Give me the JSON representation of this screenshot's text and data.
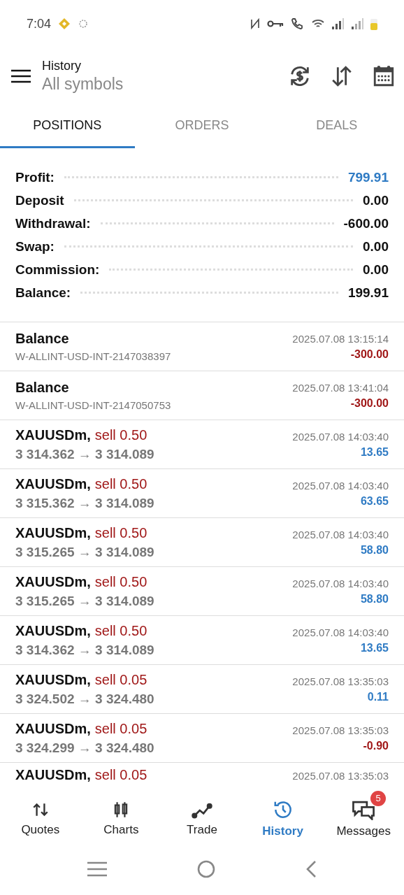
{
  "status_bar": {
    "time": "7:04"
  },
  "header": {
    "title": "History",
    "subtitle": "All symbols"
  },
  "tabs": [
    {
      "label": "POSITIONS",
      "selected": true
    },
    {
      "label": "ORDERS",
      "selected": false
    },
    {
      "label": "DEALS",
      "selected": false
    }
  ],
  "summary": [
    {
      "label": "Profit:",
      "value": "799.91",
      "highlight": true
    },
    {
      "label": "Deposit",
      "value": "0.00",
      "highlight": false
    },
    {
      "label": "Withdrawal:",
      "value": "-600.00",
      "highlight": false
    },
    {
      "label": "Swap:",
      "value": "0.00",
      "highlight": false
    },
    {
      "label": "Commission:",
      "value": "0.00",
      "highlight": false
    },
    {
      "label": "Balance:",
      "value": "199.91",
      "highlight": false
    }
  ],
  "rows": [
    {
      "kind": "balance",
      "title": "Balance",
      "detail": "W-ALLINT-USD-INT-2147038397",
      "time": "2025.07.08 13:15:14",
      "amount": "-300.00",
      "loss": true
    },
    {
      "kind": "balance",
      "title": "Balance",
      "detail": "W-ALLINT-USD-INT-2147050753",
      "time": "2025.07.08 13:41:04",
      "amount": "-300.00",
      "loss": true
    },
    {
      "kind": "trade",
      "title": "XAUUSDm,",
      "side": "sell 0.50",
      "detail": "3 314.362 → 3 314.089",
      "time": "2025.07.08 14:03:40",
      "amount": "13.65",
      "loss": false
    },
    {
      "kind": "trade",
      "title": "XAUUSDm,",
      "side": "sell 0.50",
      "detail": "3 315.362 → 3 314.089",
      "time": "2025.07.08 14:03:40",
      "amount": "63.65",
      "loss": false
    },
    {
      "kind": "trade",
      "title": "XAUUSDm,",
      "side": "sell 0.50",
      "detail": "3 315.265 → 3 314.089",
      "time": "2025.07.08 14:03:40",
      "amount": "58.80",
      "loss": false
    },
    {
      "kind": "trade",
      "title": "XAUUSDm,",
      "side": "sell 0.50",
      "detail": "3 315.265 → 3 314.089",
      "time": "2025.07.08 14:03:40",
      "amount": "58.80",
      "loss": false
    },
    {
      "kind": "trade",
      "title": "XAUUSDm,",
      "side": "sell 0.50",
      "detail": "3 314.362 → 3 314.089",
      "time": "2025.07.08 14:03:40",
      "amount": "13.65",
      "loss": false
    },
    {
      "kind": "trade",
      "title": "XAUUSDm,",
      "side": "sell 0.05",
      "detail": "3 324.502 → 3 324.480",
      "time": "2025.07.08 13:35:03",
      "amount": "0.11",
      "loss": false
    },
    {
      "kind": "trade",
      "title": "XAUUSDm,",
      "side": "sell 0.05",
      "detail": "3 324.299 → 3 324.480",
      "time": "2025.07.08 13:35:03",
      "amount": "-0.90",
      "loss": true
    },
    {
      "kind": "partial",
      "title": "XAUUSDm,",
      "side": "sell 0.05",
      "time": "2025.07.08 13:35:03"
    }
  ],
  "bottom_nav": [
    {
      "label": "Quotes",
      "selected": false
    },
    {
      "label": "Charts",
      "selected": false
    },
    {
      "label": "Trade",
      "selected": false
    },
    {
      "label": "History",
      "selected": true
    },
    {
      "label": "Messages",
      "selected": false,
      "badge": "5"
    }
  ]
}
